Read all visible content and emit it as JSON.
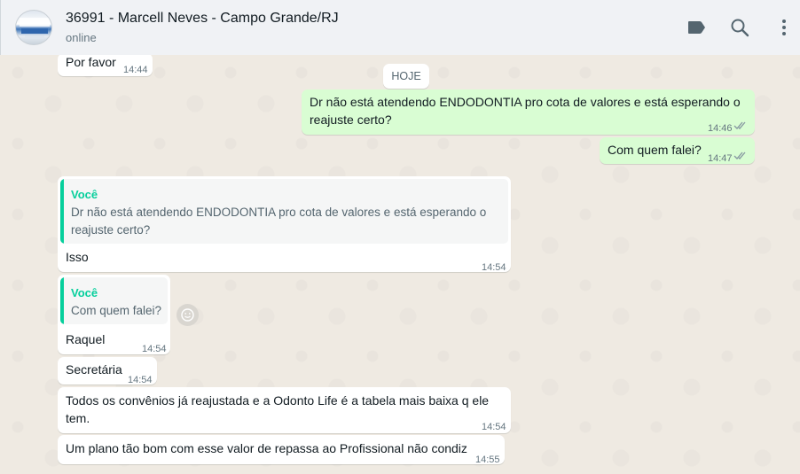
{
  "header": {
    "contact_name": "36991 - Marcell Neves - Campo Grande/RJ",
    "status": "online",
    "icons": [
      "label-icon",
      "search-icon",
      "menu-icon"
    ]
  },
  "date_separator": "HOJE",
  "messages": [
    {
      "dir": "in",
      "text": "Por favor",
      "time": "14:44"
    },
    {
      "dir": "out",
      "text_line1": "Dr não está atendendo ENDODONTIA pro cota de valores e está esperando o",
      "text_line2": "reajuste certo?",
      "time": "14:46"
    },
    {
      "dir": "out",
      "text": "Com quem falei?",
      "time": "14:47"
    },
    {
      "dir": "in",
      "quote_author": "Você",
      "quote_line1": "Dr não está atendendo ENDODONTIA pro cota de valores e está esperando o",
      "quote_line2": "reajuste certo?",
      "text": "Isso",
      "time": "14:54"
    },
    {
      "dir": "in",
      "quote_author": "Você",
      "quote_text": "Com quem falei?",
      "text": "Raquel",
      "time": "14:54"
    },
    {
      "dir": "in",
      "text": "Secretária",
      "time": "14:54"
    },
    {
      "dir": "in",
      "text_line1": "Todos os convênios já reajustada e a Odonto Life é a tabela mais baixa q ele",
      "text_line2": "tem.",
      "time": "14:54"
    },
    {
      "dir": "in",
      "text": "Um plano tão bom com esse valor de repassa ao Profissional não condiz",
      "time": "14:55"
    }
  ],
  "colors": {
    "header_bg": "#f0f2f5",
    "chat_bg": "#efeae2",
    "outgoing_bubble": "#d9fdd3",
    "incoming_bubble": "#ffffff",
    "quote_accent": "#06cf9c",
    "tick_color": "#8696a0"
  }
}
